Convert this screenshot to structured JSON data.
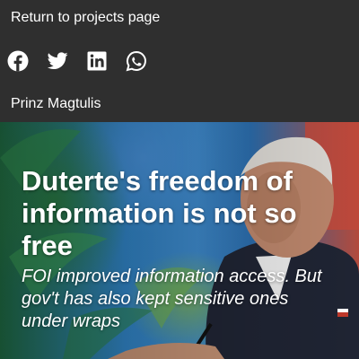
{
  "header": {
    "back_link_label": "Return to projects page",
    "share_icons": [
      "facebook-icon",
      "twitter-icon",
      "linkedin-icon",
      "whatsapp-icon"
    ],
    "author": "Prinz Magtulis"
  },
  "hero": {
    "headline": "Duterte's freedom of information is not so free",
    "subhead": "FOI improved information access. But gov't has also kept sensitive ones under wraps"
  },
  "colors": {
    "topbar_bg": "#2f2f2f",
    "text": "#ffffff"
  }
}
